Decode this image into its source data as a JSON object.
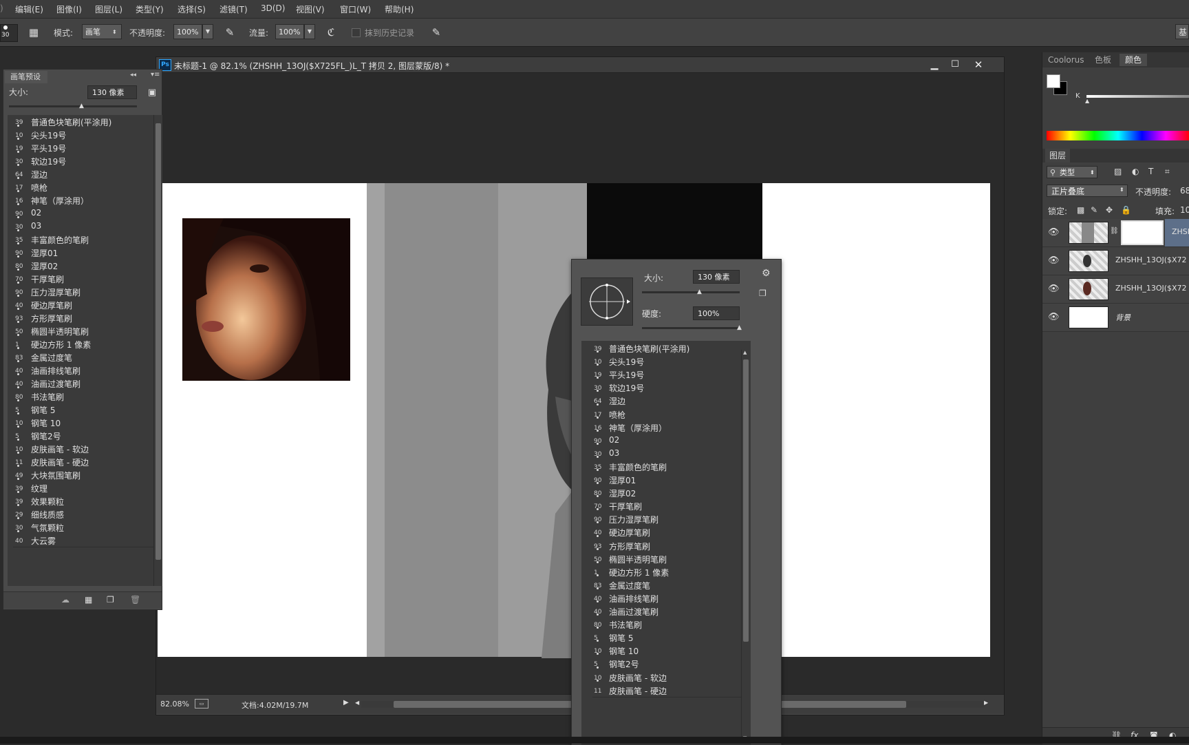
{
  "menu": [
    "编辑(E)",
    "图像(I)",
    "图层(L)",
    "类型(Y)",
    "选择(S)",
    "滤镜(T)",
    "3D(D)",
    "视图(V)",
    "窗口(W)",
    "帮助(H)"
  ],
  "options": {
    "brush_size": "30",
    "mode_label": "模式:",
    "mode_value": "画笔",
    "opacity_label": "不透明度:",
    "opacity_value": "100%",
    "flow_label": "流量:",
    "flow_value": "100%",
    "history_label": "抹到历史记录",
    "workspace_btn": "基"
  },
  "brush_panel": {
    "title": "画笔预设",
    "size_label": "大小:",
    "size_value": "130 像素",
    "items": [
      {
        "num": "39",
        "name": "普通色块笔刷(平涂用)"
      },
      {
        "num": "10",
        "name": "尖头19号"
      },
      {
        "num": "19",
        "name": "平头19号"
      },
      {
        "num": "30",
        "name": "软边19号"
      },
      {
        "num": "64",
        "name": "湿边"
      },
      {
        "num": "17",
        "name": "喷枪"
      },
      {
        "num": "16",
        "name": "神笔（厚涂用）"
      },
      {
        "num": "90",
        "name": "02"
      },
      {
        "num": "30",
        "name": "03"
      },
      {
        "num": "35",
        "name": "丰富颜色的笔刷"
      },
      {
        "num": "90",
        "name": "湿厚01"
      },
      {
        "num": "80",
        "name": "湿厚02"
      },
      {
        "num": "70",
        "name": "干厚笔刷"
      },
      {
        "num": "90",
        "name": "压力湿厚笔刷"
      },
      {
        "num": "40",
        "name": "硬边厚笔刷"
      },
      {
        "num": "93",
        "name": "方形厚笔刷"
      },
      {
        "num": "50",
        "name": "椭圆半透明笔刷"
      },
      {
        "num": "1",
        "name": "硬边方形 1 像素"
      },
      {
        "num": "83",
        "name": "金属过度笔"
      },
      {
        "num": "40",
        "name": "油画排线笔刷"
      },
      {
        "num": "40",
        "name": "油画过渡笔刷"
      },
      {
        "num": "80",
        "name": "书法笔刷"
      },
      {
        "num": "5",
        "name": "钢笔 5"
      },
      {
        "num": "10",
        "name": "钢笔 10"
      },
      {
        "num": "5",
        "name": "钢笔2号"
      },
      {
        "num": "10",
        "name": "皮肤画笔 - 软边"
      },
      {
        "num": "11",
        "name": "皮肤画笔 - 硬边"
      },
      {
        "num": "49",
        "name": "大块氛围笔刷"
      },
      {
        "num": "39",
        "name": "纹理"
      },
      {
        "num": "39",
        "name": "效果颗粒"
      },
      {
        "num": "29",
        "name": "细线质感"
      },
      {
        "num": "30",
        "name": "气氛颗粒"
      },
      {
        "num": "40",
        "name": "大云雾"
      }
    ]
  },
  "document": {
    "title": "未标题-1 @ 82.1% (ZHSHH_13OJ($X725FL_)L_T 拷贝 2, 图层蒙版/8) *",
    "zoom": "82.08%",
    "doc_info": "文档:4.02M/19.7M"
  },
  "popup": {
    "size_label": "大小:",
    "size_value": "130 像素",
    "hardness_label": "硬度:",
    "hardness_value": "100%",
    "items": [
      {
        "num": "39",
        "name": "普通色块笔刷(平涂用)"
      },
      {
        "num": "10",
        "name": "尖头19号"
      },
      {
        "num": "19",
        "name": "平头19号"
      },
      {
        "num": "30",
        "name": "软边19号"
      },
      {
        "num": "64",
        "name": "湿边"
      },
      {
        "num": "17",
        "name": "喷枪"
      },
      {
        "num": "16",
        "name": "神笔（厚涂用）"
      },
      {
        "num": "90",
        "name": "02"
      },
      {
        "num": "30",
        "name": "03"
      },
      {
        "num": "35",
        "name": "丰富颜色的笔刷"
      },
      {
        "num": "90",
        "name": "湿厚01"
      },
      {
        "num": "80",
        "name": "湿厚02"
      },
      {
        "num": "70",
        "name": "干厚笔刷"
      },
      {
        "num": "90",
        "name": "压力湿厚笔刷"
      },
      {
        "num": "40",
        "name": "硬边厚笔刷"
      },
      {
        "num": "93",
        "name": "方形厚笔刷"
      },
      {
        "num": "50",
        "name": "椭圆半透明笔刷"
      },
      {
        "num": "1",
        "name": "硬边方形 1 像素"
      },
      {
        "num": "83",
        "name": "金属过度笔"
      },
      {
        "num": "40",
        "name": "油画排线笔刷"
      },
      {
        "num": "40",
        "name": "油画过渡笔刷"
      },
      {
        "num": "80",
        "name": "书法笔刷"
      },
      {
        "num": "5",
        "name": "钢笔 5"
      },
      {
        "num": "10",
        "name": "钢笔 10"
      },
      {
        "num": "5",
        "name": "钢笔2号"
      },
      {
        "num": "10",
        "name": "皮肤画笔 - 软边"
      },
      {
        "num": "11",
        "name": "皮肤画笔 - 硬边"
      }
    ]
  },
  "right_panel": {
    "tabs": [
      "Coolorus",
      "色板",
      "颜色"
    ],
    "k_label": "K",
    "layers_title": "图层",
    "filter_label": "类型",
    "blend_mode": "正片叠底",
    "opacity_label": "不透明度:",
    "opacity_value": "68",
    "lock_label": "锁定:",
    "fill_label": "填充:",
    "fill_value": "10",
    "layers": [
      {
        "name": "ZHSH"
      },
      {
        "name": "ZHSHH_13OJ($X72"
      },
      {
        "name": "ZHSHH_13OJ($X72"
      },
      {
        "name": "背景"
      }
    ]
  },
  "colors": {
    "accent": "#31a8ff",
    "panel": "#4a4a4a",
    "selected_layer": "#5d6f89"
  }
}
